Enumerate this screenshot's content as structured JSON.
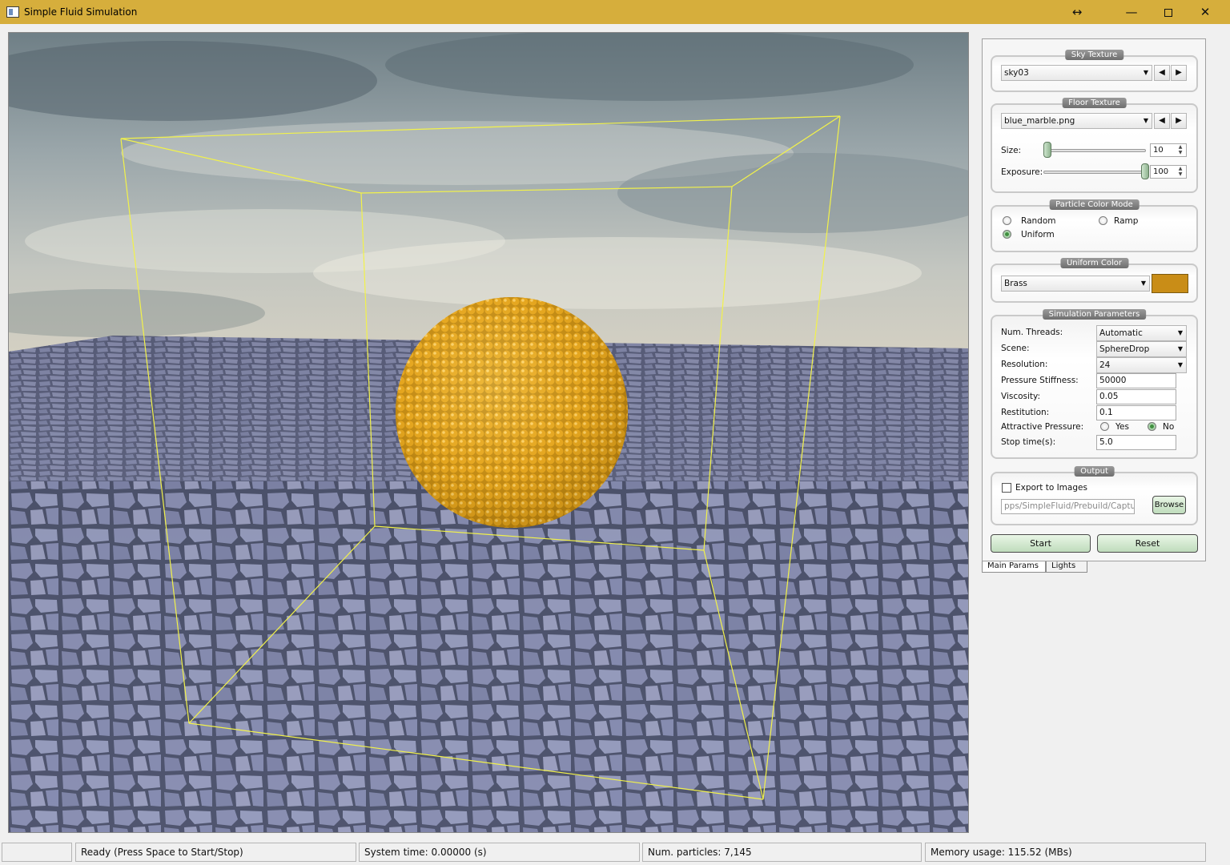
{
  "window": {
    "title": "Simple Fluid Simulation",
    "extra_icon": "↔",
    "minimize": "—",
    "close": "✕"
  },
  "colors": {
    "titlebar": "#d6ae3c",
    "bounding_box": "#f2f24a",
    "particle": "#e8a820",
    "uniform_color": "#c98d17",
    "button_green": "#bfdcbc"
  },
  "panel": {
    "sky_texture": {
      "title": "Sky Texture",
      "value": "sky03",
      "prev": "◀",
      "next": "▶"
    },
    "floor_texture": {
      "title": "Floor Texture",
      "value": "blue_marble.png",
      "prev": "◀",
      "next": "▶",
      "size_label": "Size:",
      "size_value": "10",
      "size_fraction": 0.02,
      "exposure_label": "Exposure:",
      "exposure_value": "100",
      "exposure_fraction": 1.0
    },
    "particle_color_mode": {
      "title": "Particle Color Mode",
      "options": [
        "Random",
        "Ramp",
        "Uniform"
      ],
      "selected": "Uniform"
    },
    "uniform_color": {
      "title": "Uniform Color",
      "value": "Brass"
    },
    "simulation_parameters": {
      "title": "Simulation Parameters",
      "num_threads_label": "Num. Threads:",
      "num_threads": "Automatic",
      "scene_label": "Scene:",
      "scene": "SphereDrop",
      "resolution_label": "Resolution:",
      "resolution": "24",
      "pressure_stiffness_label": "Pressure Stiffness:",
      "pressure_stiffness": "50000",
      "viscosity_label": "Viscosity:",
      "viscosity": "0.05",
      "restitution_label": "Restitution:",
      "restitution": "0.1",
      "attractive_pressure_label": "Attractive Pressure:",
      "attractive_yes": "Yes",
      "attractive_no": "No",
      "attractive_selected": "No",
      "stop_time_label": "Stop time(s):",
      "stop_time": "5.0"
    },
    "output": {
      "title": "Output",
      "export_label": "Export to Images",
      "export_checked": false,
      "path": "pps/SimpleFluid/Prebuild/Capture/",
      "browse": "Browse"
    },
    "start_button": "Start",
    "reset_button": "Reset",
    "tabs": [
      "Main Params",
      "Lights"
    ],
    "active_tab": "Main Params"
  },
  "status": {
    "ready": "Ready (Press Space to Start/Stop)",
    "system_time": "System time: 0.00000 (s)",
    "num_particles": "Num. particles: 7,145",
    "memory": "Memory usage: 115.52 (MBs)"
  }
}
